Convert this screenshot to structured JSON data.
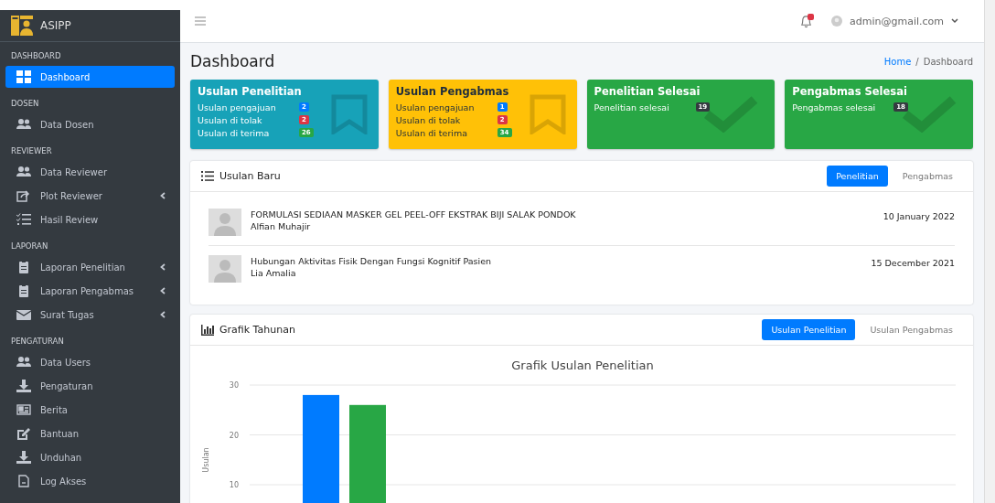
{
  "brand": {
    "name": "ASIPP"
  },
  "sidebar": {
    "sections": [
      {
        "header": "DASHBOARD",
        "items": [
          {
            "label": "Dashboard",
            "kind": "grid",
            "selected": true,
            "submenu": false
          }
        ]
      },
      {
        "header": "DOSEN",
        "items": [
          {
            "label": "Data Dosen",
            "kind": "users",
            "selected": false,
            "submenu": false
          }
        ]
      },
      {
        "header": "REVIEWER",
        "items": [
          {
            "label": "Data Reviewer",
            "kind": "users",
            "selected": false,
            "submenu": false
          },
          {
            "label": "Plot Reviewer",
            "kind": "share",
            "selected": false,
            "submenu": true
          },
          {
            "label": "Hasil Review",
            "kind": "tasks",
            "selected": false,
            "submenu": false
          }
        ]
      },
      {
        "header": "LAPORAN",
        "items": [
          {
            "label": "Laporan Penelitian",
            "kind": "clipboard",
            "selected": false,
            "submenu": true
          },
          {
            "label": "Laporan Pengabmas",
            "kind": "clipboard",
            "selected": false,
            "submenu": true
          },
          {
            "label": "Surat Tugas",
            "kind": "envelope",
            "selected": false,
            "submenu": true
          }
        ]
      },
      {
        "header": "PENGATURAN",
        "items": [
          {
            "label": "Data Users",
            "kind": "users",
            "selected": false,
            "submenu": false
          },
          {
            "label": "Pengaturan",
            "kind": "download",
            "selected": false,
            "submenu": false
          },
          {
            "label": "Berita",
            "kind": "news",
            "selected": false,
            "submenu": false
          },
          {
            "label": "Bantuan",
            "kind": "edit",
            "selected": false,
            "submenu": false
          },
          {
            "label": "Unduhan",
            "kind": "download",
            "selected": false,
            "submenu": false
          },
          {
            "label": "Log Akses",
            "kind": "file",
            "selected": false,
            "submenu": false
          }
        ]
      }
    ]
  },
  "topbar": {
    "user": "admin@gmail.com"
  },
  "page": {
    "title": "Dashboard",
    "breadcrumb_separator": "/",
    "breadcrumb": [
      {
        "label": "Home",
        "kind": "link"
      },
      {
        "label": "Dashboard",
        "kind": "current"
      }
    ]
  },
  "cards": [
    {
      "title": "Usulan Penelitian",
      "color": "#17a2b8",
      "kind": "bookmark",
      "dark_text": false,
      "rows": [
        {
          "label": "Usulan pengajuan",
          "count": "2",
          "color": "#007bff"
        },
        {
          "label": "Usulan di tolak",
          "count": "2",
          "color": "#dc3545"
        },
        {
          "label": "Usulan di terima",
          "count": "26",
          "color": "#28a745"
        }
      ]
    },
    {
      "title": "Usulan Pengabmas",
      "color": "#ffc107",
      "kind": "bookmark",
      "dark_text": true,
      "rows": [
        {
          "label": "Usulan pengajuan",
          "count": "1",
          "color": "#007bff"
        },
        {
          "label": "Usulan di tolak",
          "count": "2",
          "color": "#dc3545"
        },
        {
          "label": "Usulan di terima",
          "count": "34",
          "color": "#28a745"
        }
      ]
    },
    {
      "title": "Penelitian Selesai",
      "color": "#28a745",
      "kind": "check",
      "dark_text": false,
      "rows": [
        {
          "label": "Penelitian selesai",
          "count": "19",
          "color": "#343a40"
        }
      ]
    },
    {
      "title": "Pengabmas Selesai",
      "color": "#28a745",
      "kind": "check",
      "dark_text": false,
      "rows": [
        {
          "label": "Pengabmas selesai",
          "count": "18",
          "color": "#343a40"
        }
      ]
    }
  ],
  "usulan_baru": {
    "title": "Usulan Baru",
    "tabs": [
      {
        "label": "Penelitian",
        "selected": true
      },
      {
        "label": "Pengabmas",
        "selected": false
      }
    ],
    "items": [
      {
        "title": "FORMULASI SEDIAAN MASKER GEL PEEL-OFF EKSTRAK BIJI SALAK PONDOK",
        "author": "Alfian Muhajir",
        "date": "10 January 2022"
      },
      {
        "title": "Hubungan Aktivitas Fisik Dengan Fungsi Kognitif Pasien",
        "author": "Lia Amalia",
        "date": "15 December 2021"
      }
    ]
  },
  "grafik": {
    "title": "Grafik Tahunan",
    "tabs": [
      {
        "label": "Usulan Penelitian",
        "selected": true
      },
      {
        "label": "Usulan Pengabmas",
        "selected": false
      }
    ],
    "chart_data": {
      "type": "bar",
      "title": "Grafik Usulan Penelitian",
      "ylabel": "Usulan",
      "yticks": [
        10,
        20,
        30
      ],
      "ylim": [
        0,
        30
      ],
      "series": [
        {
          "color": "#007bff",
          "values": [
            28
          ]
        },
        {
          "color": "#28a745",
          "values": [
            26
          ]
        }
      ]
    }
  }
}
